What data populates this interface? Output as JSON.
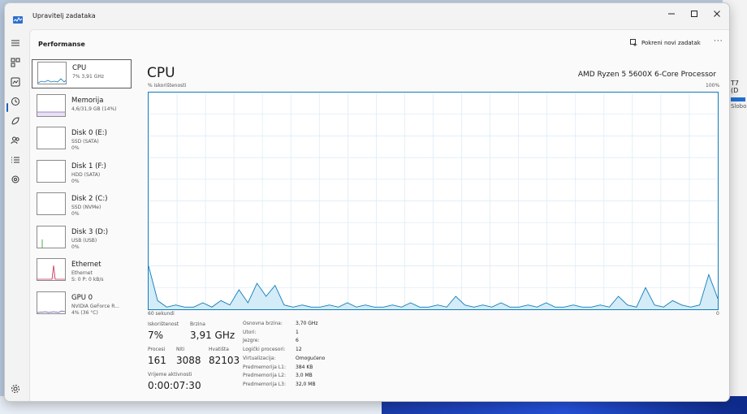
{
  "window": {
    "title": "Upravitelj zadataka"
  },
  "header": {
    "title": "Performanse",
    "run_new_task": "Pokreni novi zadatak",
    "more": "···"
  },
  "sidebar": {
    "items": [
      {
        "name": "CPU",
        "sub1": "7% 3,91 GHz",
        "sub2": "",
        "sub3": ""
      },
      {
        "name": "Memorija",
        "sub1": "4,6/31,9 GB (14%)",
        "sub2": "",
        "sub3": ""
      },
      {
        "name": "Disk 0 (E:)",
        "sub1": "SSD (SATA)",
        "sub2": "0%",
        "sub3": ""
      },
      {
        "name": "Disk 1 (F:)",
        "sub1": "HDD (SATA)",
        "sub2": "0%",
        "sub3": ""
      },
      {
        "name": "Disk 2 (C:)",
        "sub1": "SSD (NVMe)",
        "sub2": "0%",
        "sub3": ""
      },
      {
        "name": "Disk 3 (D:)",
        "sub1": "USB (USB)",
        "sub2": "0%",
        "sub3": ""
      },
      {
        "name": "Ethernet",
        "sub1": "Ethernet",
        "sub2": "S: 0 P: 0 kB/s",
        "sub3": ""
      },
      {
        "name": "GPU 0",
        "sub1": "NVIDIA GeForce R...",
        "sub2": "4% (36 °C)",
        "sub3": ""
      }
    ]
  },
  "main": {
    "title": "CPU",
    "processor": "AMD Ryzen 5 5600X 6-Core Processor",
    "ylabel": "% iskorištenosti",
    "ymax_label": "100%",
    "xlabel_left": "60 sekundi",
    "xlabel_right": "0"
  },
  "stats": {
    "utilization_label": "Iskorištenost",
    "utilization_value": "7%",
    "speed_label": "Brzina",
    "speed_value": "3,91 GHz",
    "processes_label": "Procesi",
    "processes_value": "161",
    "threads_label": "Niti",
    "threads_value": "3088",
    "handles_label": "Hvatišta",
    "handles_value": "82103",
    "uptime_label": "Vrijeme aktivnosti",
    "uptime_value": "0:00:07:30"
  },
  "specs": [
    {
      "key": "Osnovna brzina:",
      "value": "3,70 GHz"
    },
    {
      "key": "Utori:",
      "value": "1"
    },
    {
      "key": "Jezgre:",
      "value": "6"
    },
    {
      "key": "Logički procesori:",
      "value": "12"
    },
    {
      "key": "Virtualizacija:",
      "value": "Omogućeno"
    },
    {
      "key": "Predmemorija L1:",
      "value": "384 KB"
    },
    {
      "key": "Predmemorija L2:",
      "value": "3,0 MB"
    },
    {
      "key": "Predmemorija L3:",
      "value": "32,0 MB"
    }
  ],
  "background": {
    "peek_label": "T7 (D",
    "peek_sub": "Slobo"
  },
  "colors": {
    "cpu_line": "#117dbb",
    "cpu_fill": "#d4ecf8",
    "grid": "#d9eaf5",
    "ethernet": "#c7304f",
    "gpu": "#5b4fa8",
    "usb": "#4caf50",
    "selected_nav": "#1f5fbf"
  },
  "chart_data": {
    "type": "area",
    "title": "CPU",
    "ylabel": "% iskorištenosti",
    "ylim": [
      0,
      100
    ],
    "xlim": [
      60,
      0
    ],
    "x": [
      60,
      59,
      58,
      57,
      56,
      55,
      54,
      53,
      52,
      51,
      50,
      49,
      48,
      47,
      46,
      45,
      44,
      43,
      42,
      41,
      40,
      39,
      38,
      37,
      36,
      35,
      34,
      33,
      32,
      31,
      30,
      29,
      28,
      27,
      26,
      25,
      24,
      23,
      22,
      21,
      20,
      19,
      18,
      17,
      16,
      15,
      14,
      15,
      13,
      12,
      11,
      10,
      9,
      8,
      7,
      6,
      5,
      4,
      3,
      2,
      1,
      0
    ],
    "values": [
      20,
      4,
      1,
      2,
      1,
      1,
      3,
      1,
      4,
      2,
      9,
      3,
      12,
      6,
      11,
      2,
      1,
      2,
      1,
      1,
      2,
      1,
      3,
      1,
      2,
      1,
      1,
      2,
      1,
      3,
      1,
      1,
      2,
      1,
      6,
      2,
      1,
      2,
      1,
      3,
      1,
      1,
      2,
      1,
      3,
      1,
      1,
      2,
      1,
      1,
      2,
      1,
      6,
      2,
      1,
      10,
      2,
      1,
      4,
      2,
      1,
      2,
      16,
      5
    ]
  }
}
